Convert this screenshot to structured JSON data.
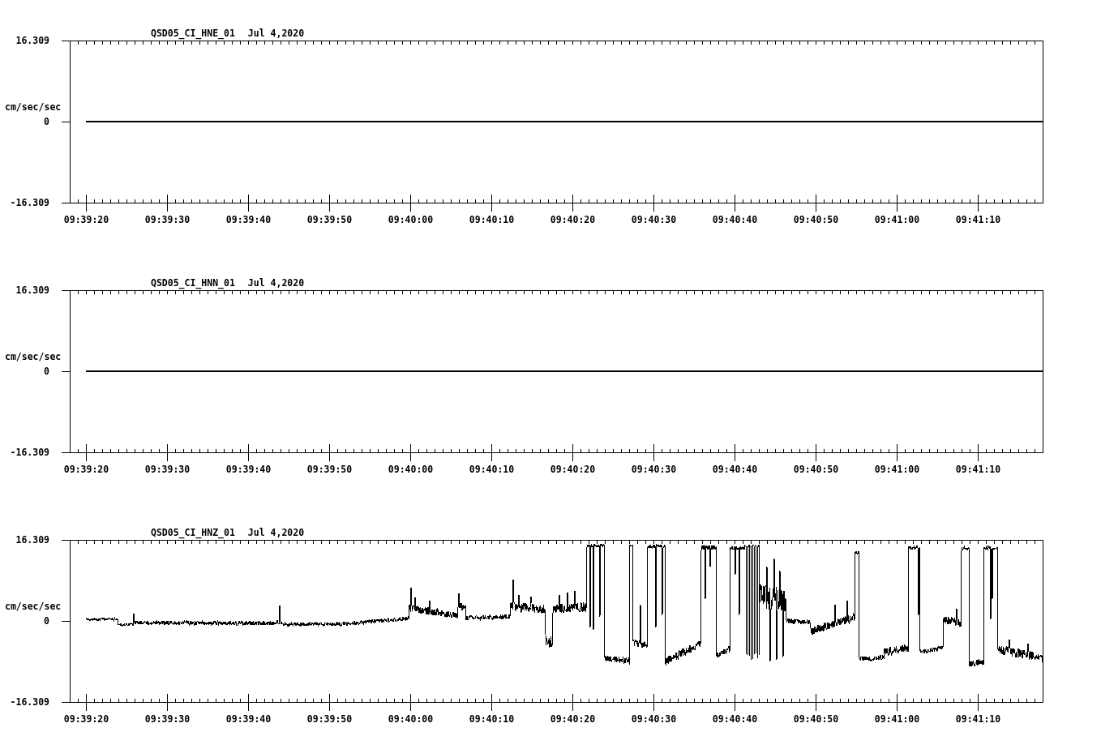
{
  "panels": [
    {
      "kind": "flat",
      "date": "Jul 4,2020",
      "chart_data": {
        "type": "line",
        "title": "QSD05_CI_HNE_01",
        "ylabel": "cm/sec/sec",
        "ylim": [
          -16.309,
          16.309
        ],
        "yticks": [
          {
            "value": 16.309,
            "label": "16.309"
          },
          {
            "value": 0,
            "label": "0"
          },
          {
            "value": -16.309,
            "label": "-16.309"
          }
        ],
        "categories": [
          null,
          null,
          "09:39:20",
          null,
          null,
          null,
          null,
          null,
          null,
          null,
          null,
          null,
          "09:39:30",
          null,
          null,
          null,
          null,
          null,
          null,
          null,
          null,
          null,
          "09:39:40",
          null,
          null,
          null,
          null,
          null,
          null,
          null,
          null,
          null,
          "09:39:50",
          null,
          null,
          null,
          null,
          null,
          null,
          null,
          null,
          null,
          "09:40:00",
          null,
          null,
          null,
          null,
          null,
          null,
          null,
          null,
          null,
          "09:40:10",
          null,
          null,
          null,
          null,
          null,
          null,
          null,
          null,
          null,
          "09:40:20",
          null,
          null,
          null,
          null,
          null,
          null,
          null,
          null,
          null,
          "09:40:30",
          null,
          null,
          null,
          null,
          null,
          null,
          null,
          null,
          null,
          "09:40:40",
          null,
          null,
          null,
          null,
          null,
          null,
          null,
          null,
          null,
          "09:40:50",
          null,
          null,
          null,
          null,
          null,
          null,
          null,
          null,
          null,
          "09:41:00",
          null,
          null,
          null,
          null,
          null,
          null,
          null,
          null,
          null,
          "09:41:10",
          null,
          null,
          null,
          null,
          null,
          null,
          null,
          null
        ],
        "series": [
          {
            "values": [
              null,
              null,
              0,
              0,
              0,
              0,
              0,
              0,
              0,
              0,
              0,
              0,
              0,
              0,
              0,
              0,
              0,
              0,
              0,
              0,
              0,
              0,
              0,
              0,
              0,
              0,
              0,
              0,
              0,
              0,
              0,
              0,
              0,
              0,
              0,
              0,
              0,
              0,
              0,
              0,
              0,
              0,
              0,
              0,
              0,
              0,
              0,
              0,
              0,
              0,
              0,
              0,
              0,
              0,
              0,
              0,
              0,
              0,
              0,
              0,
              0,
              0,
              0,
              0,
              0,
              0,
              0,
              0,
              0,
              0,
              0,
              0,
              0,
              0,
              0,
              0,
              0,
              0,
              0,
              0,
              0,
              0,
              0,
              0,
              0,
              0,
              0,
              0,
              0,
              0,
              0,
              0,
              0,
              0,
              0,
              0,
              0,
              0,
              0,
              0,
              0,
              0,
              0,
              0,
              0,
              0,
              0,
              0,
              0,
              0,
              0,
              0,
              0,
              0,
              0,
              0,
              0,
              0,
              0,
              0,
              0
            ]
          }
        ]
      }
    },
    {
      "kind": "flat",
      "date": "Jul 4,2020",
      "chart_data": {
        "type": "line",
        "title": "QSD05_CI_HNN_01",
        "ylabel": "cm/sec/sec",
        "ylim": [
          -16.309,
          16.309
        ],
        "yticks": [
          {
            "value": 16.309,
            "label": "16.309"
          },
          {
            "value": 0,
            "label": "0"
          },
          {
            "value": -16.309,
            "label": "-16.309"
          }
        ],
        "categories": [
          null,
          null,
          "09:39:20",
          null,
          null,
          null,
          null,
          null,
          null,
          null,
          null,
          null,
          "09:39:30",
          null,
          null,
          null,
          null,
          null,
          null,
          null,
          null,
          null,
          "09:39:40",
          null,
          null,
          null,
          null,
          null,
          null,
          null,
          null,
          null,
          "09:39:50",
          null,
          null,
          null,
          null,
          null,
          null,
          null,
          null,
          null,
          "09:40:00",
          null,
          null,
          null,
          null,
          null,
          null,
          null,
          null,
          null,
          "09:40:10",
          null,
          null,
          null,
          null,
          null,
          null,
          null,
          null,
          null,
          "09:40:20",
          null,
          null,
          null,
          null,
          null,
          null,
          null,
          null,
          null,
          "09:40:30",
          null,
          null,
          null,
          null,
          null,
          null,
          null,
          null,
          null,
          "09:40:40",
          null,
          null,
          null,
          null,
          null,
          null,
          null,
          null,
          null,
          "09:40:50",
          null,
          null,
          null,
          null,
          null,
          null,
          null,
          null,
          null,
          "09:41:00",
          null,
          null,
          null,
          null,
          null,
          null,
          null,
          null,
          null,
          "09:41:10",
          null,
          null,
          null,
          null,
          null,
          null,
          null,
          null
        ],
        "series": [
          {
            "values": [
              null,
              null,
              0,
              0,
              0,
              0,
              0,
              0,
              0,
              0,
              0,
              0,
              0,
              0,
              0,
              0,
              0,
              0,
              0,
              0,
              0,
              0,
              0,
              0,
              0,
              0,
              0,
              0,
              0,
              0,
              0,
              0,
              0,
              0,
              0,
              0,
              0,
              0,
              0,
              0,
              0,
              0,
              0,
              0,
              0,
              0,
              0,
              0,
              0,
              0,
              0,
              0,
              0,
              0,
              0,
              0,
              0,
              0,
              0,
              0,
              0,
              0,
              0,
              0,
              0,
              0,
              0,
              0,
              0,
              0,
              0,
              0,
              0,
              0,
              0,
              0,
              0,
              0,
              0,
              0,
              0,
              0,
              0,
              0,
              0,
              0,
              0,
              0,
              0,
              0,
              0,
              0,
              0,
              0,
              0,
              0,
              0,
              0,
              0,
              0,
              0,
              0,
              0,
              0,
              0,
              0,
              0,
              0,
              0,
              0,
              0,
              0,
              0,
              0,
              0,
              0,
              0,
              0,
              0,
              0,
              0
            ]
          }
        ]
      }
    },
    {
      "kind": "waveform",
      "title": "QSD05_CI_HNZ_01",
      "date": "Jul 4,2020",
      "ylabel": "cm/sec/sec",
      "yticks": [
        "16.309",
        "0",
        "-16.309"
      ],
      "xticks": [
        "09:39:20",
        "09:39:30",
        "09:39:40",
        "09:39:50",
        "09:40:00",
        "09:40:10",
        "09:40:20",
        "09:40:30",
        "09:40:40",
        "09:40:50",
        "09:41:00",
        "09:41:10"
      ]
    }
  ]
}
